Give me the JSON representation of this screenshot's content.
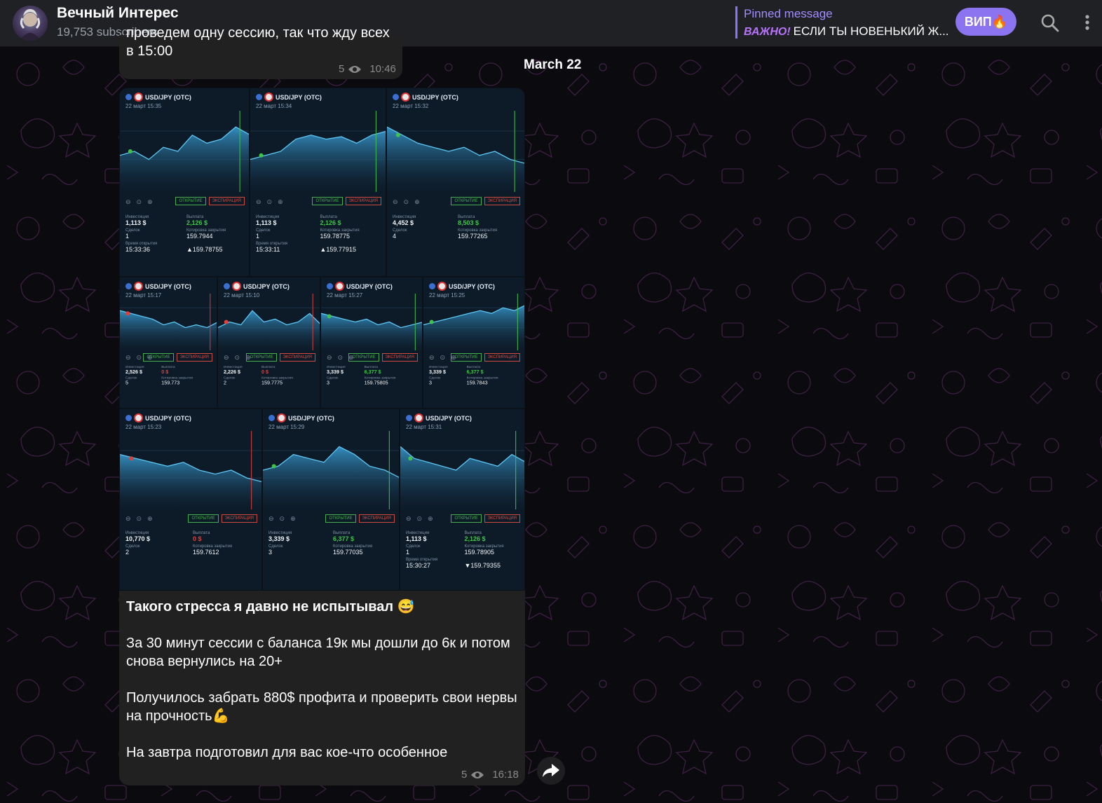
{
  "header": {
    "title": "Вечный Интерес",
    "subscribers": "19,753 subscribers",
    "pinned_title": "Pinned message",
    "pinned_important": "ВАЖНО!",
    "pinned_text": "ЕСЛИ ТЫ НОВЕНЬКИЙ Ж...",
    "vip_label": "ВИП🔥",
    "icons": [
      "search-icon",
      "more-vertical-icon"
    ]
  },
  "colors": {
    "accent": "#8c74f0",
    "header_bg": "#202124",
    "bubble_bg": "#212121",
    "green": "#3fc44a",
    "red": "#e0403a"
  },
  "prev_message": {
    "text": "проведем одну сессию, так что жду всех в 15:00",
    "views": "5",
    "time": "10:46"
  },
  "date_label": "March 22",
  "post": {
    "cards": [
      {
        "pair": "USD/JPY (OTC)",
        "date": "22 март  15:35",
        "open": "ОТКРЫТИЕ",
        "exp": "ЭКСПИРАЦИЯ",
        "inv_l": "Инвестиция",
        "inv": "1,113 $",
        "pay_l": "Выплата",
        "pay": "2,126 $",
        "pay_color": "green",
        "deals_l": "Сделок",
        "deals": "1",
        "quote_l": "Котировка закрытия",
        "quote": "159.7944",
        "ex_l": "Время открытия",
        "ex": "15:33:36",
        "ex2": "▲159.78755"
      },
      {
        "pair": "USD/JPY (OTC)",
        "date": "22 март  15:34",
        "open": "ОТКРЫТИЕ",
        "exp": "ЭКСПИРАЦИЯ",
        "inv_l": "Инвестиция",
        "inv": "1,113 $",
        "pay_l": "Выплата",
        "pay": "2,126 $",
        "pay_color": "green",
        "deals_l": "Сделок",
        "deals": "1",
        "quote_l": "Котировка закрытия",
        "quote": "159.78775",
        "ex_l": "Время открытия",
        "ex": "15:33:11",
        "ex2": "▲159.77915"
      },
      {
        "pair": "USD/JPY (OTC)",
        "date": "22 март  15:32",
        "open": "ОТКРЫТИЕ",
        "exp": "ЭКСПИРАЦИЯ",
        "inv_l": "Инвестиция",
        "inv": "4,452 $",
        "pay_l": "Выплата",
        "pay": "8,503 $",
        "pay_color": "green",
        "deals_l": "Сделок",
        "deals": "4",
        "quote_l": "Котировка закрытия",
        "quote": "159.77265",
        "ex_l": "",
        "ex": "",
        "ex2": ""
      },
      {
        "pair": "USD/JPY (OTC)",
        "date": "22 март  15:17",
        "open": "ОТКРЫТИЕ",
        "exp": "ЭКСПИРАЦИЯ",
        "inv_l": "Инвестиция",
        "inv": "2,526 $",
        "pay_l": "Выплата",
        "pay": "0 $",
        "pay_color": "red",
        "deals_l": "Сделок",
        "deals": "5",
        "quote_l": "Котировка закрытия",
        "quote": "159.773",
        "ex_l": "",
        "ex": "",
        "ex2": ""
      },
      {
        "pair": "USD/JPY (OTC)",
        "date": "22 март  15:10",
        "open": "ОТКРЫТИЕ",
        "exp": "ЭКСПИРАЦИЯ",
        "inv_l": "Инвестиция",
        "inv": "2,226 $",
        "pay_l": "Выплата",
        "pay": "0 $",
        "pay_color": "red",
        "deals_l": "Сделок",
        "deals": "2",
        "quote_l": "Котировка закрытия",
        "quote": "159.7775",
        "ex_l": "",
        "ex": "",
        "ex2": ""
      },
      {
        "pair": "USD/JPY (OTC)",
        "date": "22 март  15:27",
        "open": "ОТКРЫТИЕ",
        "exp": "ЭКСПИРАЦИЯ",
        "inv_l": "Инвестиция",
        "inv": "3,339 $",
        "pay_l": "Выплата",
        "pay": "6,377 $",
        "pay_color": "green",
        "deals_l": "Сделок",
        "deals": "3",
        "quote_l": "Котировка закрытия",
        "quote": "159.75805",
        "ex_l": "",
        "ex": "",
        "ex2": ""
      },
      {
        "pair": "USD/JPY (OTC)",
        "date": "22 март  15:25",
        "open": "ОТКРЫТИЕ",
        "exp": "ЭКСПИРАЦИЯ",
        "inv_l": "Инвестиция",
        "inv": "3,339 $",
        "pay_l": "Выплата",
        "pay": "6,377 $",
        "pay_color": "green",
        "deals_l": "Сделок",
        "deals": "3",
        "quote_l": "Котировка закрытия",
        "quote": "159.7843",
        "ex_l": "",
        "ex": "",
        "ex2": ""
      },
      {
        "pair": "USD/JPY (OTC)",
        "date": "22 март  15:23",
        "open": "ОТКРЫТИЕ",
        "exp": "ЭКСПИРАЦИЯ",
        "inv_l": "Инвестиция",
        "inv": "10,770 $",
        "pay_l": "Выплата",
        "pay": "0 $",
        "pay_color": "red",
        "deals_l": "Сделок",
        "deals": "2",
        "quote_l": "Котировка закрытия",
        "quote": "159.7612",
        "ex_l": "",
        "ex": "",
        "ex2": ""
      },
      {
        "pair": "USD/JPY (OTC)",
        "date": "22 март  15:29",
        "open": "ОТКРЫТИЕ",
        "exp": "ЭКСПИРАЦИЯ",
        "inv_l": "Инвестиция",
        "inv": "3,339 $",
        "pay_l": "Выплата",
        "pay": "6,377 $",
        "pay_color": "green",
        "deals_l": "Сделок",
        "deals": "3",
        "quote_l": "Котировка закрытия",
        "quote": "159.77035",
        "ex_l": "",
        "ex": "",
        "ex2": ""
      },
      {
        "pair": "USD/JPY (OTC)",
        "date": "22 март  15:31",
        "open": "ОТКРЫТИЕ",
        "exp": "ЭКСПИРАЦИЯ",
        "inv_l": "Инвестиция",
        "inv": "1,113 $",
        "pay_l": "Выплата",
        "pay": "2,126 $",
        "pay_color": "green",
        "deals_l": "Сделок",
        "deals": "1",
        "quote_l": "Котировка закрытия",
        "quote": "159.78905",
        "ex_l": "Время открытия",
        "ex": "15:30:27",
        "ex2": "▼159.79355"
      }
    ],
    "caption": [
      "Такого стресса я давно не испытывал 😅",
      "За 30 минут сессии с баланса 19к мы дошли до 6к и потом снова вернулись на 20+",
      "Получилось забрать 880$ профита и проверить свои нервы на прочность💪",
      "На завтра подготовил для вас кое-что особенное"
    ],
    "views": "5",
    "time": "16:18"
  }
}
